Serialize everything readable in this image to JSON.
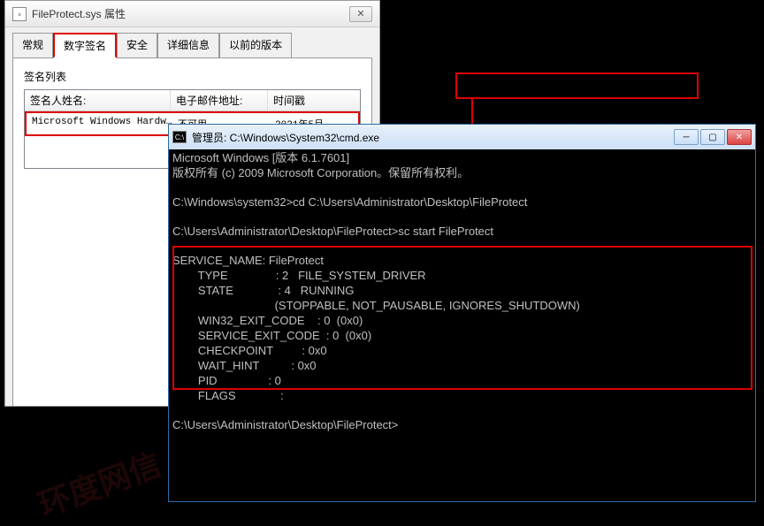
{
  "prop": {
    "title": "FileProtect.sys 属性",
    "tabs": {
      "general": "常规",
      "sig": "数字签名",
      "security": "安全",
      "details": "详细信息",
      "prev": "以前的版本"
    },
    "sig_list_label": "签名列表",
    "cols": {
      "signer": "签名人姓名:",
      "email": "电子邮件地址:",
      "ts": "时间戳"
    },
    "row": {
      "signer": "Microsoft Windows Hardw…",
      "email": "不可用",
      "ts": "2021年5月"
    }
  },
  "cmd": {
    "title": "管理员: C:\\Windows\\System32\\cmd.exe",
    "l1": "Microsoft Windows [版本 6.1.7601]",
    "l2": "版权所有 (c) 2009 Microsoft Corporation。保留所有权利。",
    "l3": "C:\\Windows\\system32>cd C:\\Users\\Administrator\\Desktop\\FileProtect",
    "l4": "C:\\Users\\Administrator\\Desktop\\FileProtect>sc start FileProtect",
    "svc_name": "SERVICE_NAME: FileProtect",
    "type_l": "        TYPE               : 2   FILE_SYSTEM_DRIVER",
    "state_l": "        STATE              : 4   RUNNING",
    "state_f": "                                (STOPPABLE, NOT_PAUSABLE, IGNORES_SHUTDOWN)",
    "w32_l": "        WIN32_EXIT_CODE    : 0  (0x0)",
    "sxc_l": "        SERVICE_EXIT_CODE  : 0  (0x0)",
    "chk_l": "        CHECKPOINT         : 0x0",
    "wh_l": "        WAIT_HINT          : 0x0",
    "pid_l": "        PID                : 0",
    "flg_l": "        FLAGS              :",
    "prompt": "C:\\Users\\Administrator\\Desktop\\FileProtect>"
  },
  "watermark": "环度网信"
}
